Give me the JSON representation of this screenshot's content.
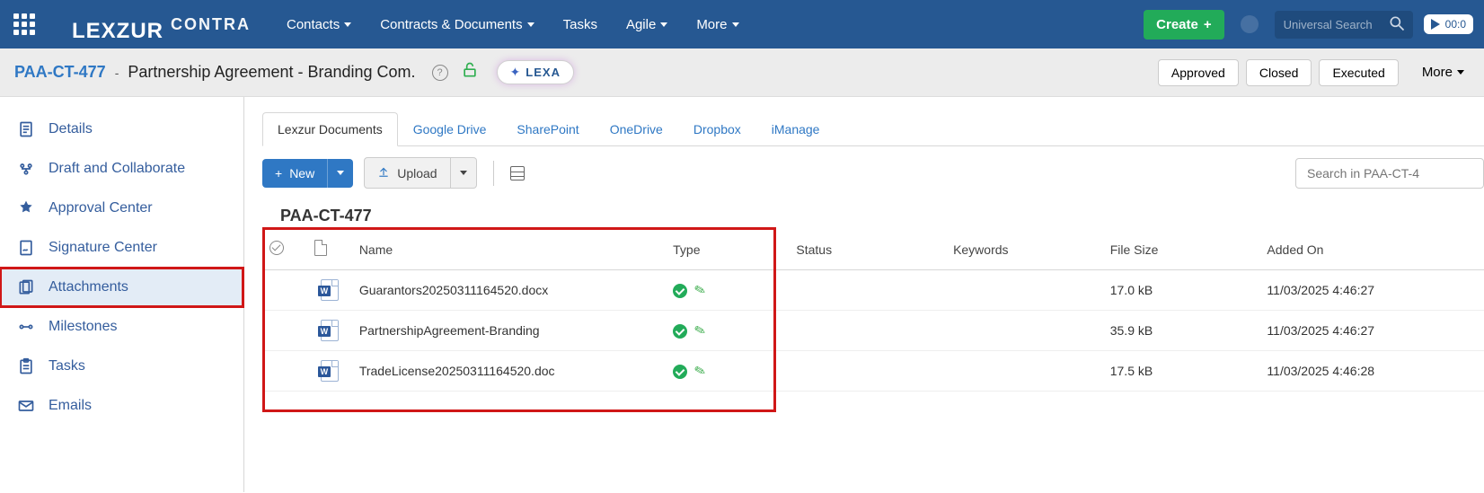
{
  "nav": {
    "links": [
      "Contacts",
      "Contracts & Documents",
      "Tasks",
      "Agile",
      "More"
    ],
    "create": "Create",
    "search_placeholder": "Universal Search",
    "timer": "00:0"
  },
  "brand": {
    "main": "LEXZUR",
    "sub": "CONTRA"
  },
  "subheader": {
    "doc_id": "PAA-CT-477",
    "title": "Partnership Agreement - Branding Com.",
    "lexa": "LEXA",
    "statuses": [
      "Approved",
      "Closed",
      "Executed"
    ],
    "more": "More"
  },
  "sidebar": {
    "items": [
      {
        "label": "Details",
        "icon": "details"
      },
      {
        "label": "Draft and Collaborate",
        "icon": "collab"
      },
      {
        "label": "Approval Center",
        "icon": "approval"
      },
      {
        "label": "Signature Center",
        "icon": "signature"
      },
      {
        "label": "Attachments",
        "icon": "attach",
        "active": true
      },
      {
        "label": "Milestones",
        "icon": "milestones"
      },
      {
        "label": "Tasks",
        "icon": "tasks"
      },
      {
        "label": "Emails",
        "icon": "emails"
      }
    ]
  },
  "docTabs": [
    "Lexzur Documents",
    "Google Drive",
    "SharePoint",
    "OneDrive",
    "Dropbox",
    "iManage"
  ],
  "toolbar": {
    "new": "New",
    "upload": "Upload",
    "search_placeholder": "Search in PAA-CT-4"
  },
  "folder_title": "PAA-CT-477",
  "columns": {
    "name": "Name",
    "type": "Type",
    "status": "Status",
    "keywords": "Keywords",
    "filesize": "File Size",
    "added": "Added On"
  },
  "files": [
    {
      "name": "Guarantors20250311164520.docx",
      "size": "17.0 kB",
      "added": "11/03/2025 4:46:27"
    },
    {
      "name": "PartnershipAgreement-Branding",
      "size": "35.9 kB",
      "added": "11/03/2025 4:46:27"
    },
    {
      "name": "TradeLicense20250311164520.doc",
      "size": "17.5 kB",
      "added": "11/03/2025 4:46:28"
    }
  ]
}
